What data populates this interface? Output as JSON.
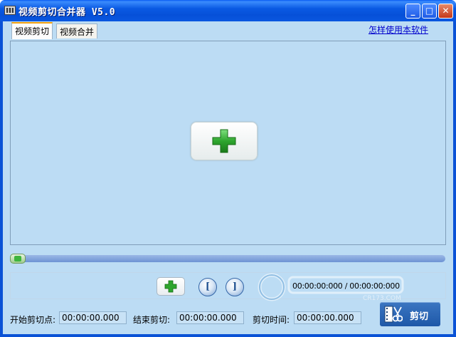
{
  "window": {
    "title": "视频剪切合并器 V5.0",
    "buttons": {
      "minimize": "_",
      "maximize": "□",
      "close": "✕"
    }
  },
  "tabs": [
    {
      "label": "视频剪切",
      "active": true
    },
    {
      "label": "视频合并",
      "active": false
    }
  ],
  "help_link": "怎样使用本软件",
  "player": {
    "add_icon": "plus-icon",
    "progress": 0,
    "time_readout": "00:00:00:000 / 00:00:00:000",
    "mark_in_glyph": "[",
    "mark_out_glyph": "]",
    "watermark": "CR173.COM"
  },
  "fields": {
    "start_label": "开始剪切点:",
    "start_value": "00:00:00.000",
    "end_label": "结束剪切:",
    "end_value": "00:00:00.000",
    "duration_label": "剪切时间:",
    "duration_value": "00:00:00.000"
  },
  "cut_button": {
    "label": "剪切",
    "icon": "scissors-icon"
  },
  "colors": {
    "titlebar": "#0a5ae3",
    "background": "#bcdcf4",
    "plus": "#2ea52e",
    "cut_button": "#2a64b0"
  }
}
